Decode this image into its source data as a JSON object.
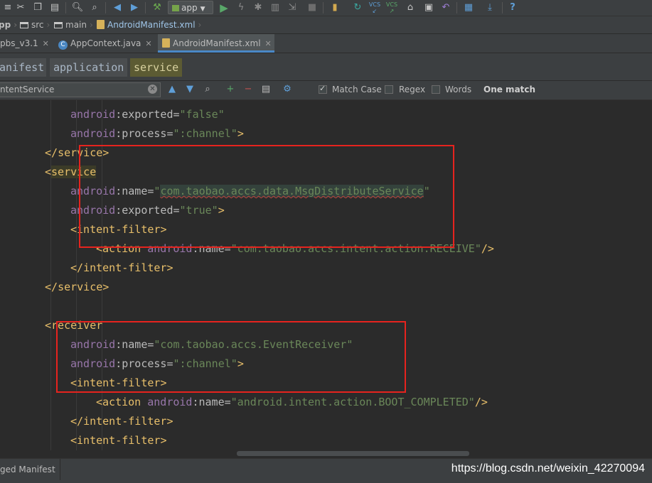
{
  "toolbar": {
    "run_config": "app",
    "icons": [
      "cut-icon",
      "copy-icon",
      "paste-icon",
      "find-icon",
      "replace-icon",
      "back-icon",
      "forward-icon",
      "build-icon",
      "run-icon",
      "apply-changes-icon",
      "debug-icon",
      "profile-icon",
      "attach-icon",
      "stop-icon",
      "avd-icon",
      "sync-icon",
      "vcs-update-icon",
      "vcs-commit-icon",
      "vcs-history-icon",
      "vcs-revert-icon",
      "project-structure-icon",
      "sdk-manager-icon",
      "help-icon"
    ],
    "vcs_label": "VCS"
  },
  "breadcrumb": {
    "items": [
      "pp",
      "src",
      "main",
      "AndroidManifest.xml"
    ]
  },
  "tabs": [
    {
      "label": "pbs_v3.1",
      "active": false
    },
    {
      "label": "AppContext.java",
      "active": false
    },
    {
      "label": "AndroidManifest.xml",
      "active": true
    }
  ],
  "xml_path": {
    "items": [
      "anifest",
      "application",
      "service"
    ]
  },
  "search": {
    "value": "ntentService",
    "match_case_label": "Match Case",
    "match_case_checked": true,
    "regex_label": "Regex",
    "regex_checked": false,
    "words_label": "Words",
    "words_checked": false,
    "status": "One match"
  },
  "editor": {
    "lines": [
      {
        "indent": 2,
        "tokens": [
          [
            "ns",
            "android"
          ],
          [
            "eq",
            ":"
          ],
          [
            "attr",
            "exported"
          ],
          [
            "eq",
            "="
          ],
          [
            "str",
            "\"false\""
          ]
        ]
      },
      {
        "indent": 2,
        "tokens": [
          [
            "ns",
            "android"
          ],
          [
            "eq",
            ":"
          ],
          [
            "attr",
            "process"
          ],
          [
            "eq",
            "="
          ],
          [
            "str",
            "\":channel\""
          ],
          [
            "br",
            ">"
          ]
        ]
      },
      {
        "indent": 1,
        "tokens": [
          [
            "br",
            "</"
          ],
          [
            "tag",
            "service"
          ],
          [
            "br",
            ">"
          ]
        ]
      },
      {
        "indent": 1,
        "tokens": [
          [
            "br",
            "<"
          ],
          [
            "taghl",
            "service"
          ]
        ]
      },
      {
        "indent": 2,
        "tokens": [
          [
            "ns",
            "android"
          ],
          [
            "eq",
            ":"
          ],
          [
            "attr",
            "name"
          ],
          [
            "eq",
            "="
          ],
          [
            "str",
            "\""
          ],
          [
            "strhl",
            "com.taobao.accs.data.MsgDistributeService"
          ],
          [
            "str",
            "\""
          ]
        ]
      },
      {
        "indent": 2,
        "tokens": [
          [
            "ns",
            "android"
          ],
          [
            "eq",
            ":"
          ],
          [
            "attr",
            "exported"
          ],
          [
            "eq",
            "="
          ],
          [
            "str",
            "\"true\""
          ],
          [
            "br",
            ">"
          ]
        ]
      },
      {
        "indent": 2,
        "tokens": [
          [
            "br",
            "<"
          ],
          [
            "tag",
            "intent-filter"
          ],
          [
            "br",
            ">"
          ]
        ]
      },
      {
        "indent": 3,
        "tokens": [
          [
            "br",
            "<"
          ],
          [
            "tag",
            "action "
          ],
          [
            "ns",
            "android"
          ],
          [
            "eq",
            ":"
          ],
          [
            "attr",
            "name"
          ],
          [
            "eq",
            "="
          ],
          [
            "str",
            "\"com.taobao.accs.intent.action.RECEIVE\""
          ],
          [
            "br",
            "/>"
          ]
        ]
      },
      {
        "indent": 2,
        "tokens": [
          [
            "br",
            "</"
          ],
          [
            "tag",
            "intent-filter"
          ],
          [
            "br",
            ">"
          ]
        ]
      },
      {
        "indent": 1,
        "tokens": [
          [
            "br",
            "</"
          ],
          [
            "tag",
            "service"
          ],
          [
            "br",
            ">"
          ]
        ]
      },
      {
        "indent": 0,
        "tokens": []
      },
      {
        "indent": 1,
        "tokens": [
          [
            "br",
            "<"
          ],
          [
            "tag",
            "receiver"
          ]
        ]
      },
      {
        "indent": 2,
        "tokens": [
          [
            "ns",
            "android"
          ],
          [
            "eq",
            ":"
          ],
          [
            "attr",
            "name"
          ],
          [
            "eq",
            "="
          ],
          [
            "str",
            "\"com.taobao.accs.EventReceiver\""
          ]
        ]
      },
      {
        "indent": 2,
        "tokens": [
          [
            "ns",
            "android"
          ],
          [
            "eq",
            ":"
          ],
          [
            "attr",
            "process"
          ],
          [
            "eq",
            "="
          ],
          [
            "str",
            "\":channel\""
          ],
          [
            "br",
            ">"
          ]
        ]
      },
      {
        "indent": 2,
        "tokens": [
          [
            "br",
            "<"
          ],
          [
            "tag",
            "intent-filter"
          ],
          [
            "br",
            ">"
          ]
        ]
      },
      {
        "indent": 3,
        "tokens": [
          [
            "br",
            "<"
          ],
          [
            "tag",
            "action "
          ],
          [
            "ns",
            "android"
          ],
          [
            "eq",
            ":"
          ],
          [
            "attr",
            "name"
          ],
          [
            "eq",
            "="
          ],
          [
            "str",
            "\"android.intent.action.BOOT_COMPLETED\""
          ],
          [
            "br",
            "/>"
          ]
        ]
      },
      {
        "indent": 2,
        "tokens": [
          [
            "br",
            "</"
          ],
          [
            "tag",
            "intent-filter"
          ],
          [
            "br",
            ">"
          ]
        ]
      },
      {
        "indent": 2,
        "tokens": [
          [
            "br",
            "<"
          ],
          [
            "tag",
            "intent-filter"
          ],
          [
            "br",
            ">"
          ]
        ]
      }
    ]
  },
  "bottom": {
    "merged_tab": "ged Manifest",
    "watermark": "https://blog.csdn.net/weixin_42270094"
  },
  "colors": {
    "annotation_box": "#e6231e",
    "tag": "#e8bf6a",
    "namespace": "#9876aa",
    "string": "#6a8759",
    "accent": "#4a88c7"
  }
}
